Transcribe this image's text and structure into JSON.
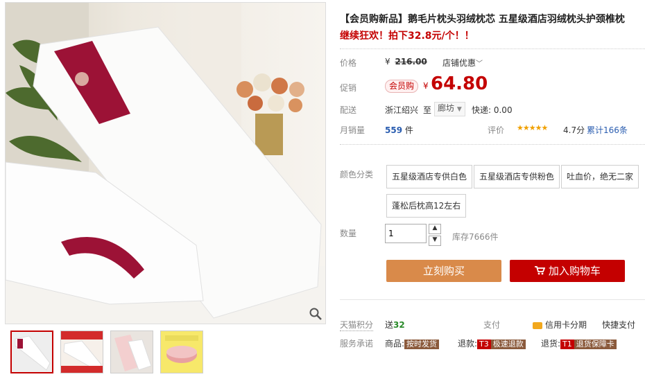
{
  "product": {
    "title": "【会员购新品】鹅毛片枕头羽绒枕芯 五星级酒店羽绒枕头护颈椎枕",
    "subtitle": "继续狂欢！拍下32.8元/个！！"
  },
  "price": {
    "label": "价格",
    "currency": "¥",
    "original": "216.00",
    "store_discount": "店铺优惠"
  },
  "promo": {
    "label": "促销",
    "badge": "会员购",
    "currency": "¥",
    "price": "64.80"
  },
  "shipping": {
    "label": "配送",
    "from": "浙江绍兴",
    "to_word": "至",
    "to": "廊坊",
    "express": "快递: 0.00"
  },
  "sales": {
    "label": "月销量",
    "count": "559",
    "unit": "件",
    "rating_label": "评价",
    "stars": "★★★★★",
    "score": "4.7分",
    "total": "累计166条"
  },
  "options": {
    "label": "颜色分类",
    "items": [
      "五星级酒店专供白色",
      "五星级酒店专供粉色",
      "吐血价，绝无二家",
      "蓬松后枕高12左右"
    ]
  },
  "quantity": {
    "label": "数量",
    "value": "1",
    "stock": "库存7666件"
  },
  "buttons": {
    "buy": "立刻购买",
    "cart": "加入购物车"
  },
  "points": {
    "label": "天猫积分",
    "send": "送",
    "value": "32",
    "pay": "支付",
    "credit": "信用卡分期",
    "quick": "快捷支付"
  },
  "service": {
    "label": "服务承诺",
    "goods": "商品:",
    "goods_badge": "按时发货",
    "refund": "退款:",
    "refund_code": "T3",
    "refund_badge": "极速退款",
    "return": "退货:",
    "return_code": "T1",
    "return_badge": "退货保障卡"
  },
  "colors": {
    "accent": "#c40000",
    "buy_btn": "#d98a4a",
    "cart_btn": "#c40000"
  }
}
